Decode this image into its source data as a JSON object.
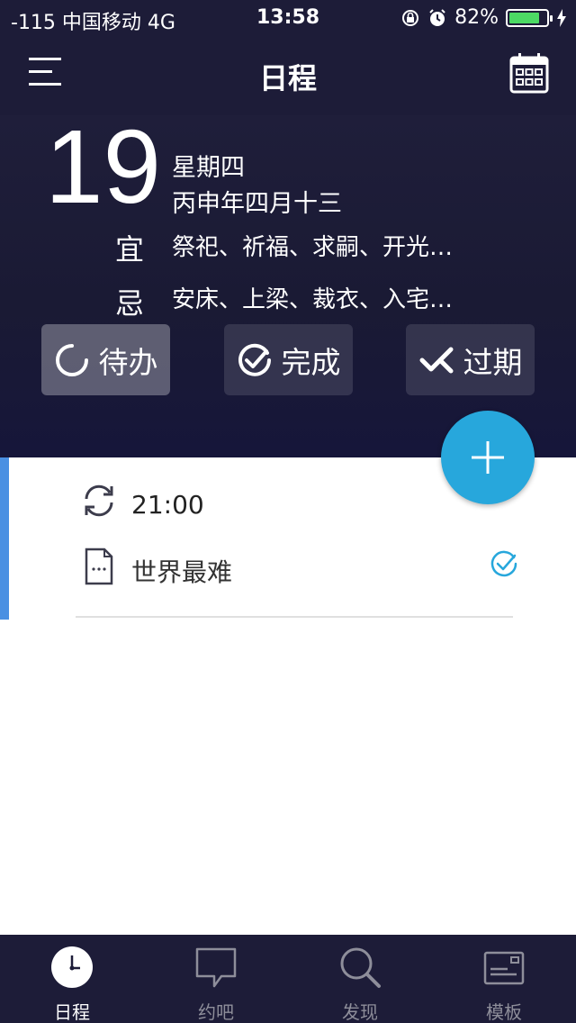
{
  "status_bar": {
    "carrier": "-115 中国移动  4G",
    "time": "13:58",
    "battery_percent": "82%",
    "battery_level": 0.82
  },
  "nav": {
    "title": "日程",
    "menu_icon": "menu-icon",
    "calendar_icon": "calendar-icon"
  },
  "date": {
    "day": "19",
    "weekday": "星期四",
    "lunar": "丙申年四月十三",
    "yi_label": "宜",
    "yi_text": "祭祀、祈福、求嗣、开光…",
    "ji_label": "忌",
    "ji_text": "安床、上梁、裁衣、入宅…"
  },
  "filters": [
    {
      "label": "待办",
      "icon": "loading-circle-icon",
      "active": true
    },
    {
      "label": "完成",
      "icon": "check-circle-icon",
      "active": false
    },
    {
      "label": "过期",
      "icon": "check-x-icon",
      "active": false
    }
  ],
  "fab": {
    "icon": "plus-icon"
  },
  "events": [
    {
      "time": "21:00",
      "title": "世界最难",
      "accent_color": "#4a90e2",
      "completed": true
    }
  ],
  "tabs": [
    {
      "label": "日程",
      "icon": "clock-icon",
      "active": true
    },
    {
      "label": "约吧",
      "icon": "chat-bubble-icon",
      "active": false
    },
    {
      "label": "发现",
      "icon": "search-icon",
      "active": false
    },
    {
      "label": "模板",
      "icon": "template-card-icon",
      "active": false
    }
  ],
  "colors": {
    "header_bg": "#1d1c38",
    "fab": "#27a7dc",
    "accent": "#4a90e2",
    "battery": "#4cd964"
  }
}
